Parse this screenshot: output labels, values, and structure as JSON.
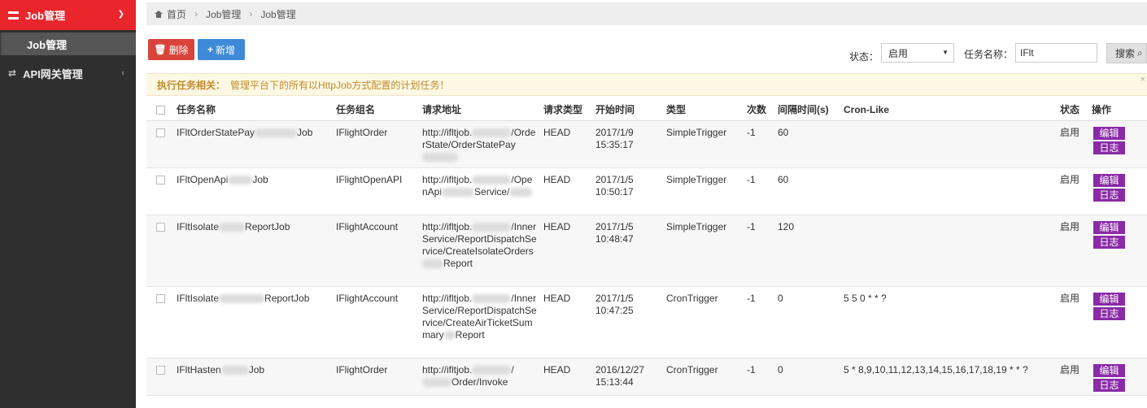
{
  "sidebar": {
    "active_menu": "Job管理",
    "submenu": "Job管理",
    "menu_api": "API网关管理"
  },
  "breadcrumb": {
    "home": "首页",
    "level1": "Job管理",
    "level2": "Job管理"
  },
  "toolbar": {
    "delete_label": "删除",
    "add_label": "新增",
    "status_label": "状态：",
    "status_value": "启用",
    "name_label": "任务名称：",
    "name_value": "IFlt",
    "search_label": "搜索"
  },
  "alert": {
    "title": "执行任务相关：",
    "message": "管理平台下的所有以HttpJob方式配置的计划任务！"
  },
  "table": {
    "headers": [
      "任务名称",
      "任务组名",
      "请求地址",
      "请求类型",
      "开始时间",
      "类型",
      "次数",
      "间隔时间(s)",
      "Cron-Like",
      "状态",
      "操作"
    ],
    "edit_label": "编辑",
    "log_label": "日志",
    "rows": [
      {
        "name_a": "IFltOrderStatePay",
        "name_b": "Job",
        "group": "IFlightOrder",
        "url_a": "http://ifltjob.",
        "url_b": "/",
        "url_c": "OrderState/OrderStatePay",
        "url_d": "",
        "type": "HEAD",
        "date": "2017/1/9",
        "time": "15:35:17",
        "trigger": "SimpleTrigger",
        "count": "-1",
        "interval": "60",
        "cron": "",
        "status": "启用"
      },
      {
        "name_a": "IFltOpenApi",
        "name_b": "Job",
        "group": "IFlightOpenAPI",
        "url_a": "http://ifltjob.",
        "url_b": "/",
        "url_c": "OpenApi",
        "url_d": "Service/",
        "type": "HEAD",
        "date": "2017/1/5",
        "time": "10:50:17",
        "trigger": "SimpleTrigger",
        "count": "-1",
        "interval": "60",
        "cron": "",
        "status": "启用"
      },
      {
        "name_a": "IFltIsolate",
        "name_b": "ReportJob",
        "group": "IFlightAccount",
        "url_a": "http://ifltjob.",
        "url_b": "/",
        "url_c": "InnerService/ReportDispatchService/CreateIsolateOrders",
        "url_d": "Report",
        "type": "HEAD",
        "date": "2017/1/5",
        "time": "10:48:47",
        "trigger": "SimpleTrigger",
        "count": "-1",
        "interval": "120",
        "cron": "",
        "status": "启用"
      },
      {
        "name_a": "IFltIsolate",
        "name_b": "ReportJob",
        "group": "IFlightAccount",
        "url_a": "http://ifltjob.",
        "url_b": "/",
        "url_c": "InnerService/ReportDispatchService/CreateAirTicketSummary",
        "url_d": "Report",
        "type": "HEAD",
        "date": "2017/1/5",
        "time": "10:47:25",
        "trigger": "CronTrigger",
        "count": "-1",
        "interval": "0",
        "cron": "5 5 0 * * ?",
        "status": "启用"
      },
      {
        "name_a": "IFltHasten",
        "name_b": "Job",
        "group": "IFlightOrder",
        "url_a": "http://ifltjob.",
        "url_b": "/",
        "url_c": "",
        "url_d": "Order/Invoke",
        "type": "HEAD",
        "date": "2016/12/27",
        "time": "15:13:44",
        "trigger": "CronTrigger",
        "count": "-1",
        "interval": "0",
        "cron": "5 * 8,9,10,11,12,13,14,15,16,17,18,19 * * ?",
        "status": "启用"
      }
    ]
  }
}
